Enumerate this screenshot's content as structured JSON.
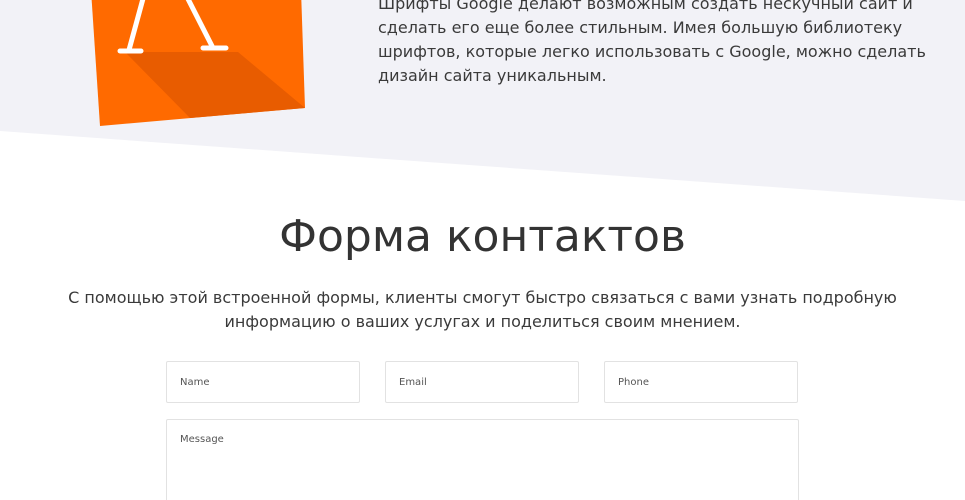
{
  "colors": {
    "band": "#f2f2f7",
    "accent": "#ff6a00",
    "accent_dark": "#e65a00",
    "text": "#333333"
  },
  "feature": {
    "icon": "google-fonts-letter-a-icon",
    "lines": [
      "Шрифты Google делают возможным создать нескучный сайт и",
      "сделать его еще более стильным. Имея большую библиотеку",
      "шрифтов, которые легко  использовать с Google, можно сделать",
      "дизайн сайта уникальным."
    ]
  },
  "contact": {
    "title": "Форма контактов",
    "description_lines": [
      "С помощью этой встроенной формы, клиенты смогут быстро связаться с вами узнать подробную",
      "информацию о ваших услугах и поделиться своим мнением."
    ],
    "fields": {
      "name_placeholder": "Name",
      "email_placeholder": "Email",
      "phone_placeholder": "Phone",
      "message_placeholder": "Message"
    }
  }
}
